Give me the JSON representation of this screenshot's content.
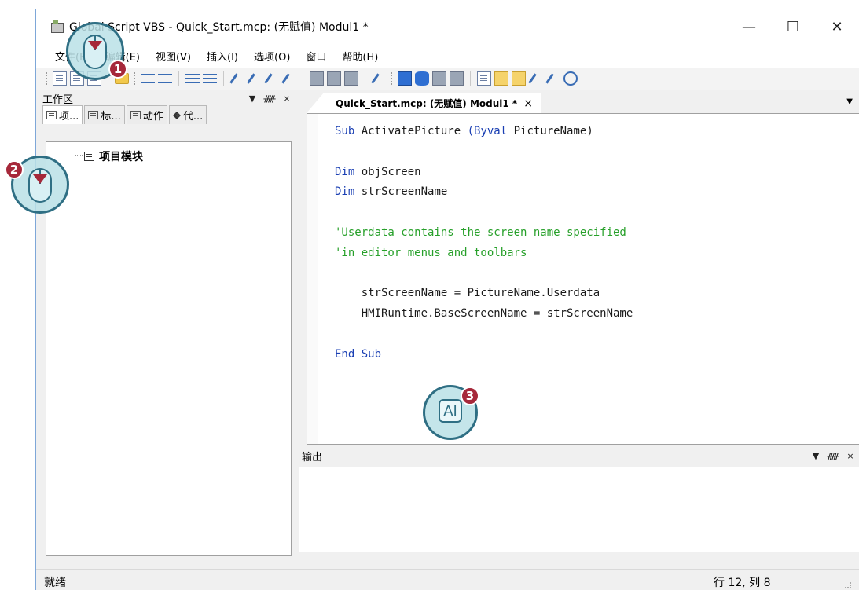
{
  "window": {
    "title": "Global Script VBS - Quick_Start.mcp: (无赋值) Modul1 *",
    "minimize_glyph": "—",
    "maximize_glyph": "☐",
    "close_glyph": "✕"
  },
  "menu": [
    "文件(F)",
    "编辑(E)",
    "视图(V)",
    "插入(I)",
    "选项(O)",
    "窗口",
    "帮助(H)"
  ],
  "workspace": {
    "title": "工作区",
    "tabs": [
      "项...",
      "标...",
      "动作",
      "代..."
    ],
    "tree_item": "项目模块"
  },
  "editor": {
    "tab_label": "Quick_Start.mcp: (无赋值) Modul1 *",
    "tab_close": "×",
    "code_lines": [
      {
        "type": "code",
        "parts": [
          [
            "kw",
            "Sub"
          ],
          [
            "tx",
            " ActivatePicture "
          ],
          [
            "kw",
            "(Byval"
          ],
          [
            "tx",
            " PictureName)"
          ]
        ]
      },
      {
        "type": "blank"
      },
      {
        "type": "code",
        "parts": [
          [
            "kw",
            "Dim"
          ],
          [
            "tx",
            " objScreen"
          ]
        ]
      },
      {
        "type": "code",
        "parts": [
          [
            "kw",
            "Dim"
          ],
          [
            "tx",
            " strScreenName"
          ]
        ]
      },
      {
        "type": "blank"
      },
      {
        "type": "code",
        "parts": [
          [
            "cm",
            "'Userdata contains the screen name specified"
          ]
        ]
      },
      {
        "type": "code",
        "parts": [
          [
            "cm",
            "'in editor menus and toolbars"
          ]
        ]
      },
      {
        "type": "blank"
      },
      {
        "type": "code",
        "parts": [
          [
            "tx",
            "    strScreenName = PictureName.Userdata"
          ]
        ]
      },
      {
        "type": "code",
        "parts": [
          [
            "tx",
            "    HMIRuntime.BaseScreenName = strScreenName"
          ]
        ]
      },
      {
        "type": "blank"
      },
      {
        "type": "code",
        "parts": [
          [
            "kw",
            "End Sub"
          ]
        ]
      }
    ]
  },
  "output": {
    "title": "输出"
  },
  "panel_controls": {
    "dropdown": "▼",
    "pin": "ᚏ",
    "close": "×"
  },
  "status": {
    "left": "就绪",
    "position": "行 12, 列 8"
  },
  "callouts": [
    {
      "number": "1",
      "icon": "mouse-left-click-icon"
    },
    {
      "number": "2",
      "icon": "mouse-left-click-icon"
    },
    {
      "number": "3",
      "icon": "text-cursor-icon",
      "label": "AI"
    }
  ],
  "colors": {
    "keyword": "#1a3fb3",
    "comment": "#27a02a",
    "callout_badge": "#a6283a",
    "callout_border": "#2f6f84"
  }
}
